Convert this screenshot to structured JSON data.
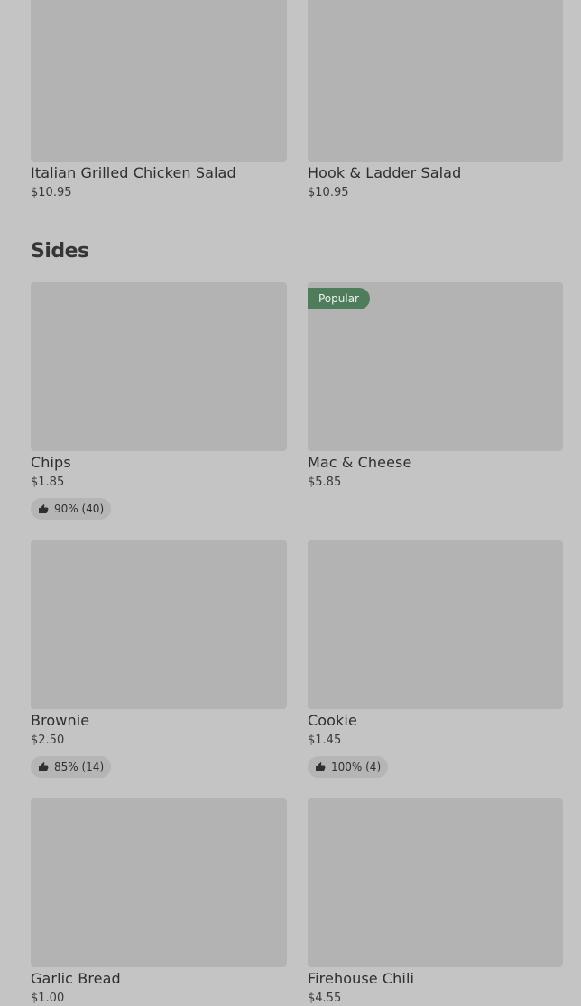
{
  "top_row": [
    {
      "name": "Italian Grilled Chicken Salad",
      "price": "$10.95"
    },
    {
      "name": "Hook & Ladder Salad",
      "price": "$10.95"
    }
  ],
  "section": {
    "title": "Sides"
  },
  "items": [
    {
      "name": "Chips",
      "price": "$1.85",
      "rating": "90% (40)"
    },
    {
      "name": "Mac & Cheese",
      "price": "$5.85",
      "badge": "Popular"
    },
    {
      "name": "Brownie",
      "price": "$2.50",
      "rating": "85% (14)"
    },
    {
      "name": "Cookie",
      "price": "$1.45",
      "rating": "100% (4)"
    },
    {
      "name": "Garlic Bread",
      "price": "$1.00"
    },
    {
      "name": "Firehouse Chili",
      "price": "$4.55"
    }
  ],
  "icons": {
    "rating": "thumbs-up-icon"
  },
  "colors": {
    "background": "#c4c4c4",
    "image_placeholder": "#b3b3b3",
    "popular_badge": "#4f7d5b"
  }
}
